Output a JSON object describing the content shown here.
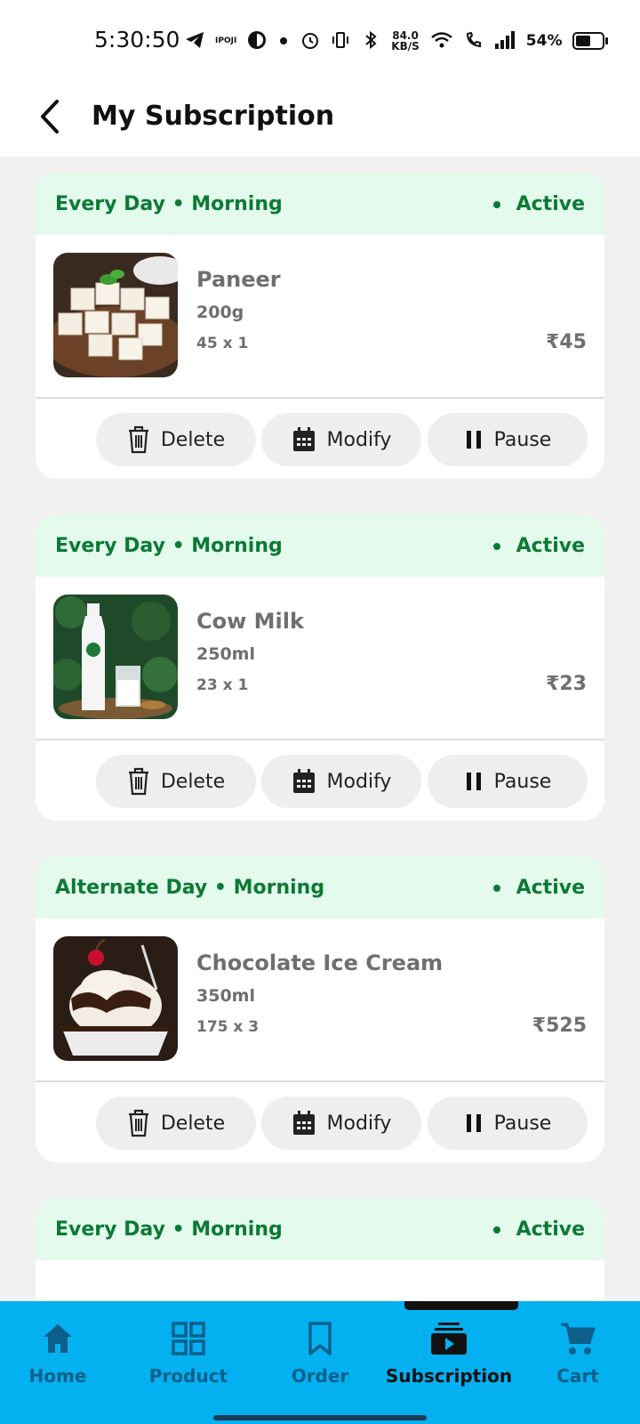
{
  "status_bar": {
    "time": "5:30:50",
    "carrier_tag": "IPOJI",
    "net_speed_value": "84.0",
    "net_speed_unit": "KB/S",
    "battery_percent": "54%",
    "battery_level": 0.54
  },
  "header": {
    "title": "My Subscription"
  },
  "actions": {
    "delete": "Delete",
    "modify": "Modify",
    "pause": "Pause"
  },
  "subscriptions": [
    {
      "schedule": "Every Day • Morning",
      "status": "Active",
      "name": "Paneer",
      "size": "200g",
      "qty": "45 x 1",
      "price": "₹45"
    },
    {
      "schedule": "Every Day • Morning",
      "status": "Active",
      "name": "Cow Milk",
      "size": "250ml",
      "qty": "23 x 1",
      "price": "₹23"
    },
    {
      "schedule": "Alternate Day • Morning",
      "status": "Active",
      "name": "Chocolate Ice Cream",
      "size": "350ml",
      "qty": "175 x 3",
      "price": "₹525"
    },
    {
      "schedule": "Every Day • Morning",
      "status": "Active"
    }
  ],
  "bottom_nav": {
    "items": [
      {
        "label": "Home",
        "icon": "home-icon"
      },
      {
        "label": "Product",
        "icon": "grid-icon"
      },
      {
        "label": "Order",
        "icon": "bookmark-icon"
      },
      {
        "label": "Subscription",
        "icon": "subscription-icon"
      },
      {
        "label": "Cart",
        "icon": "cart-icon"
      }
    ],
    "active": "Subscription"
  },
  "colors": {
    "accent_green": "#0c7a35",
    "card_header_bg": "#e3faec",
    "nav_bg": "#03b1f1",
    "nav_label": "#0d5f8a"
  }
}
